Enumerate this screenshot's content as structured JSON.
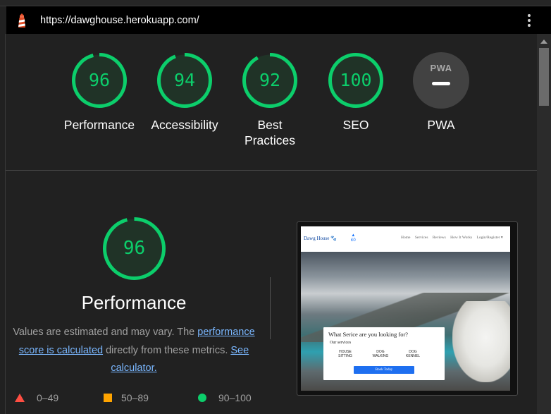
{
  "header": {
    "icon": "lighthouse-icon",
    "url": "https://dawghouse.herokuapp.com/",
    "menu_icon": "more-vert-icon"
  },
  "summary_scores": [
    {
      "label": "Performance",
      "score": "96"
    },
    {
      "label": "Accessibility",
      "score": "94"
    },
    {
      "label": "Best Practices",
      "score": "92"
    },
    {
      "label": "SEO",
      "score": "100"
    },
    {
      "label": "PWA",
      "badge": "PWA"
    }
  ],
  "performance": {
    "score": "96",
    "title": "Performance",
    "desc_prefix": "Values are estimated and may vary. The ",
    "desc_link1": "performance score is calculated",
    "desc_middle": " directly from these metrics. ",
    "desc_link2": "See calculator."
  },
  "legend": [
    {
      "range": "0–49",
      "icon": "fail-triangle-icon"
    },
    {
      "range": "50–89",
      "icon": "average-square-icon"
    },
    {
      "range": "90–100",
      "icon": "pass-circle-icon"
    }
  ],
  "colors": {
    "pass": "#0cce6b",
    "average": "#ffa400",
    "fail": "#ff4e42",
    "link": "#7ab7ff"
  },
  "screenshot": {
    "brand": "Dawg House",
    "cart_count": "£0",
    "nav_links": [
      "Home",
      "Services",
      "Reviews",
      "How It Works",
      "Login/Register ▾"
    ],
    "question": "What Serice are you looking for?",
    "our_services": "Our services",
    "services": [
      "HOUSE SITTING",
      "DOG WALKING",
      "DOG KENNEL"
    ],
    "button": "Book Today"
  }
}
